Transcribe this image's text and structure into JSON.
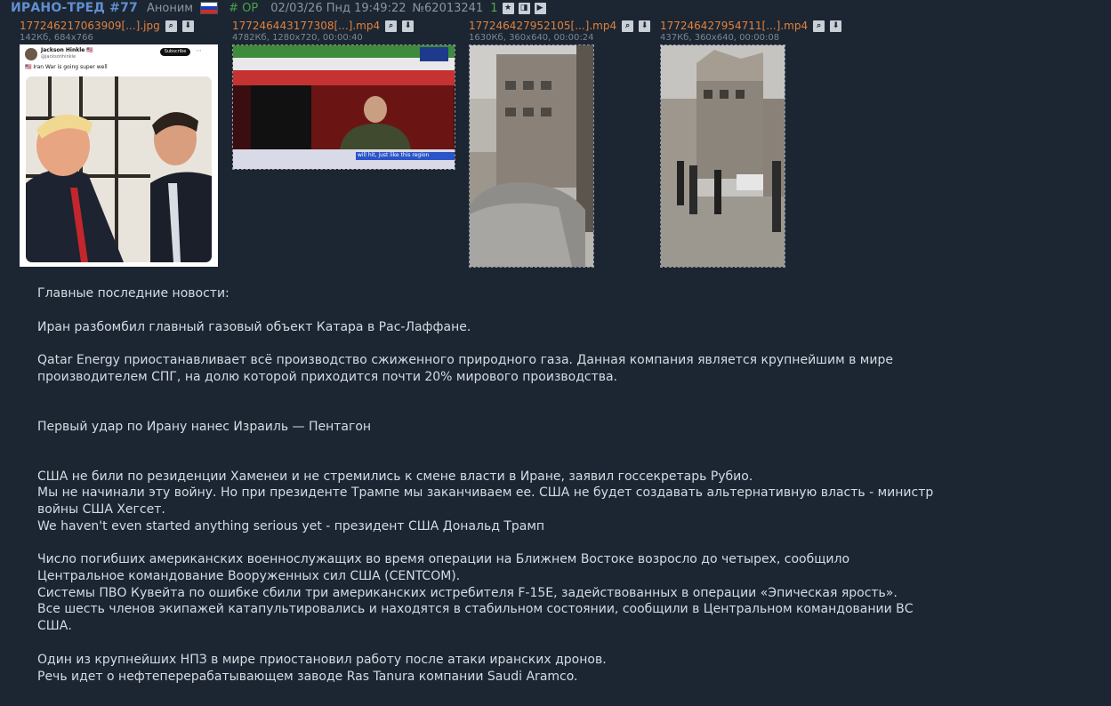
{
  "post": {
    "subject": "ИРАНО-ТРЕД #77",
    "author": "Аноним",
    "op_label": "# OP",
    "datetime": "02/03/26 Пнд 19:49:22",
    "post_number": "№62013241",
    "replies_count": "1",
    "icons": [
      "star-icon",
      "clip-icon",
      "play-icon"
    ]
  },
  "files": [
    {
      "name": "177246217063909[...].jpg",
      "info": "142Кб, 684x766"
    },
    {
      "name": "177246443177308[...].mp4",
      "info": "4782Кб, 1280x720, 00:00:40"
    },
    {
      "name": "177246427952105[...].mp4",
      "info": "1630Кб, 360x640, 00:00:24"
    },
    {
      "name": "177246427954711[...].mp4",
      "info": "437Кб, 360x640, 00:00:08"
    }
  ],
  "thumbs": {
    "tweet_name": "Jackson Hinkle 🇺🇸",
    "tweet_handle": "@jacksonhinkle",
    "tweet_subscribe": "Subscribe",
    "tweet_text": "🇺🇸 Iran War is going super well",
    "tv_caption": "will hit, just like this region"
  },
  "body": {
    "paragraphs": [
      [
        "Главные последние новости:"
      ],
      [
        "Иран разбомбил главный газовый объект Катара в Рас-Лаффане."
      ],
      [
        "Qatar Energy приостанавливает всё производство сжиженного природного газа. Данная компания является крупнейшим в мире производителем СПГ, на долю которой приходится почти 20% мирового производства."
      ],
      [
        "Первый удар по Ирану нанес Израиль — Пентагон"
      ],
      [
        "США не били по резиденции Хаменеи и не стремились к смене власти в Иране, заявил госсекретарь Рубио.",
        "Мы не начинали эту войну. Но при президенте Трампе мы заканчиваем ее. США не будет создавать альтернативную власть - министр войны США Хегсет.",
        "We haven't even started anything serious yet - президент США Дональд Трамп"
      ],
      [
        "Число погибших американских военнослужащих во время операции на Ближнем Востоке возросло до четырех, сообщило Центральное командование Вооруженных сил США (CENTCOM).",
        "Системы ПВО Кувейта по ошибке сбили три американских истребителя F-15E, задействованных в операции «Эпическая ярость».",
        "Все шесть членов экипажей катапультировались и находятся в стабильном состоянии, сообщили в Центральном командовании ВС США."
      ],
      [
        "Один из крупнейших НПЗ в мире приостановил работу после атаки иранских дронов.",
        "Речь идет о нефтеперерабатывающем заводе Ras Tanura компании Saudi Aramco."
      ]
    ]
  },
  "colors": {
    "background": "#1c2532",
    "subject": "#5f8fd1",
    "filename": "#e0823c",
    "op": "#47a447"
  }
}
